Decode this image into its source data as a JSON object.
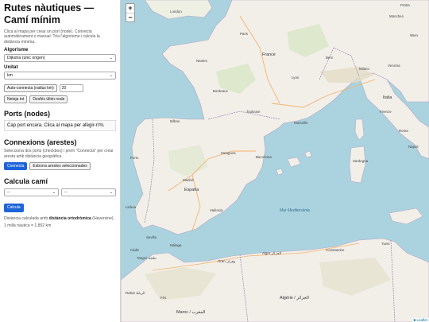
{
  "sidebar": {
    "title": "Rutes nàutiques — Camí mínim",
    "intro": "Clica al mapa per crear un port (node). Connecta automàticament o manual. Tria l'algorisme i calcula la distància mínima.",
    "algorithm": {
      "label": "Algorisme",
      "value": "Dijkstra (únic origen)"
    },
    "unit": {
      "label": "Unitat",
      "value": "km"
    },
    "autoconnect": {
      "button": "Auto-connecta (radius km)",
      "value": "20"
    },
    "clear_all": "Neteja tot",
    "undo_last": "Desfés últim node",
    "ports": {
      "heading": "Ports (nodes)",
      "empty": "Cap port encara. Clica al mapa per afegir-n'hi."
    },
    "connections": {
      "heading": "Connexions (arestes)",
      "help": "Selecciona dos ports (checkbox) i prem \"Connecta\" per crear aresta amb distància geogràfica.",
      "connect": "Connecta",
      "delete_selected": "Esborra arestes seleccionades"
    },
    "path": {
      "heading": "Calcula camí",
      "from": "--",
      "to": "--",
      "calculate": "Calcula",
      "note_prefix": "Distància calculada amb ",
      "note_bold": "distància ortodròmica",
      "note_suffix": " (Haversine).",
      "nautical": "1 milla nàutica = 1,852 km"
    }
  },
  "map": {
    "zoom_in": "+",
    "zoom_out": "−",
    "attribution": "Leaflet",
    "labels": {
      "london": "London",
      "paris": "Paris",
      "france": "France",
      "lyon": "Lyon",
      "nantes": "Nantes",
      "bordeaux": "Bordeaux",
      "toulouse": "Toulouse",
      "marseille": "Marseille",
      "espana": "España",
      "madrid": "Madrid",
      "barcelona": "Barcelona",
      "valencia": "València",
      "porto": "Porto",
      "lisboa": "Lisboa",
      "sevilla": "Sevilla",
      "malaga": "Málaga",
      "zaragoza": "Zaragoza",
      "bilbao": "Bilbao",
      "italia": "Italia",
      "roma": "Roma",
      "milano": "Milano",
      "bern": "Bern",
      "munchen": "München",
      "praha": "Praha",
      "wien": "Wien",
      "venezia": "Venezia",
      "firenze": "Firenze",
      "napoli": "Napoli",
      "sardegna": "Sardegna",
      "tunis": "Tunis",
      "alger": "Alger الجزائر",
      "algerie": "Algérie / الجزائر",
      "oran": "Oran وهران",
      "rabat": "Rabat الرباط",
      "fes": "Fès",
      "maroc": "Maroc / المغرب",
      "constantine": "Constantine",
      "cadiz": "Cádiz",
      "tanger": "Tanger طنجة",
      "mediterranean": "Mar Mediterrània"
    }
  }
}
